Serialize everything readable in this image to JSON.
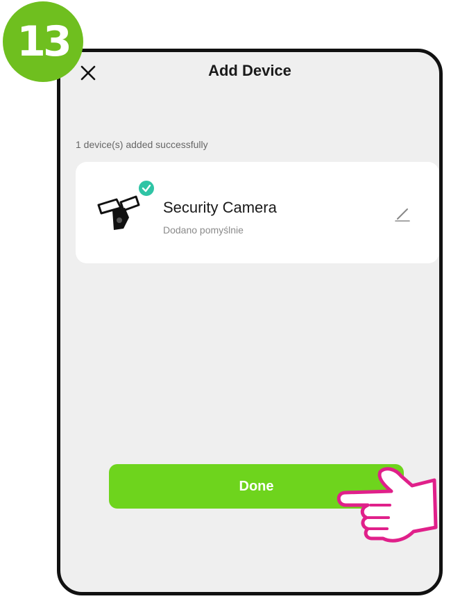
{
  "step": {
    "number": "13",
    "color": "#6fbf1f"
  },
  "header": {
    "title": "Add Device",
    "close_icon": "close-icon"
  },
  "status_line": "1 device(s) added successfully",
  "device": {
    "name": "Security Camera",
    "status": "Dodano pomyślnie",
    "icon": "security-camera-icon",
    "badge_icon": "check-icon",
    "badge_color": "#2fc4a5",
    "edit_icon": "pencil-icon"
  },
  "done_button": {
    "label": "Done",
    "color": "#6ed41d"
  },
  "pointer": {
    "icon": "hand-pointer-icon",
    "color": "#e0208a"
  }
}
